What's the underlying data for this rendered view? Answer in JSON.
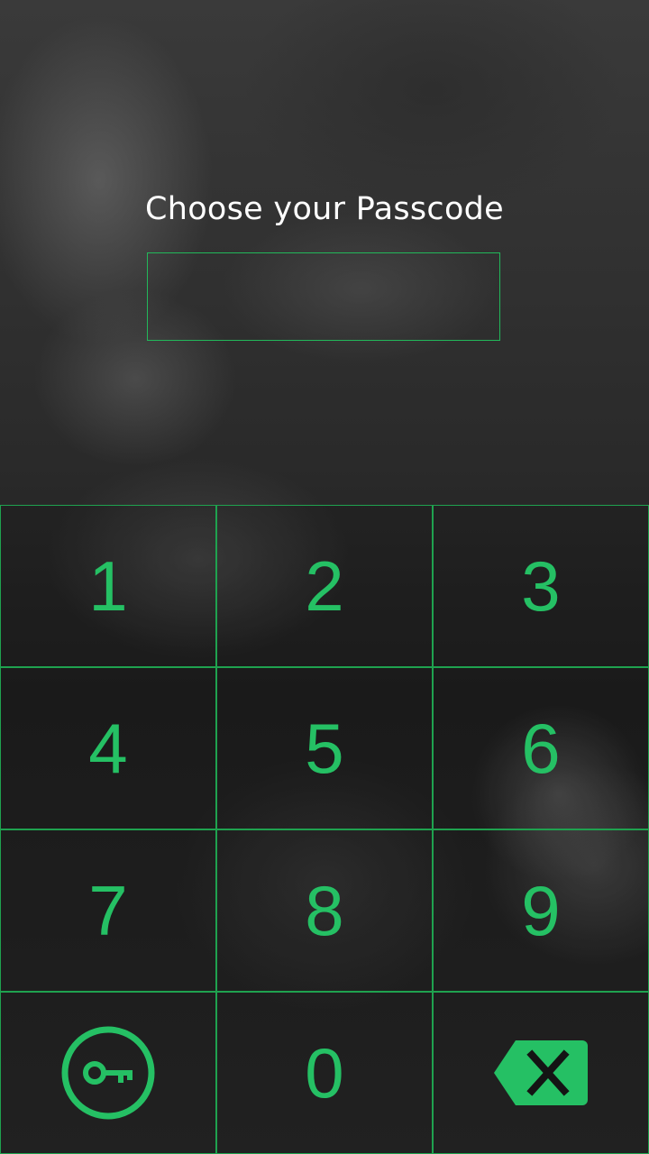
{
  "screen": {
    "title": "Choose your Passcode"
  },
  "keypad": {
    "keys": [
      {
        "label": "1"
      },
      {
        "label": "2"
      },
      {
        "label": "3"
      },
      {
        "label": "4"
      },
      {
        "label": "5"
      },
      {
        "label": "6"
      },
      {
        "label": "7"
      },
      {
        "label": "8"
      },
      {
        "label": "9"
      },
      {
        "label": "",
        "icon": "key-icon"
      },
      {
        "label": "0"
      },
      {
        "label": "",
        "icon": "backspace-icon"
      }
    ]
  },
  "colors": {
    "accent": "#25c064",
    "border": "#1fa24f",
    "title": "#ffffff"
  }
}
